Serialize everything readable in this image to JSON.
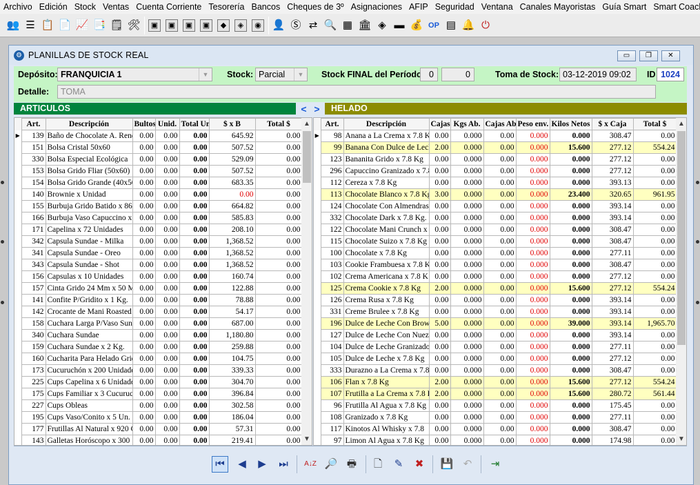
{
  "menu": [
    "Archivo",
    "Edición",
    "Stock",
    "Ventas",
    "Cuenta Corriente",
    "Tesorería",
    "Bancos",
    "Cheques de 3º",
    "Asignaciones",
    "AFIP",
    "Seguridad",
    "Ventana",
    "Canales Mayoristas",
    "Guía Smart",
    "Smart Coach"
  ],
  "toolbar": {
    "group1": [
      "people-icon",
      "list-icon",
      "clipboard-icon",
      "document-icon",
      "chart-icon",
      "report-icon",
      "notepad-icon",
      "tools-icon"
    ],
    "group2": [
      "box1-icon",
      "box2-icon",
      "box3-icon",
      "box4-icon",
      "box5-icon",
      "box6-icon",
      "box7-icon"
    ],
    "group3": [
      "user-icon",
      "money-icon",
      "transfer-icon",
      "search-icon",
      "calculator-icon",
      "bank-icon",
      "stack-icon",
      "card-icon",
      "wallet-icon",
      "op-icon",
      "receipt-icon",
      "bell-icon",
      "power-icon"
    ],
    "group3_glyphs": [
      "👤",
      "Ⓢ",
      "⇄",
      "🔍",
      "▦",
      "🏛",
      "◈",
      "▬",
      "💰",
      "OP",
      "▤",
      "🔔",
      "⏻"
    ]
  },
  "window": {
    "title": "PLANILLAS DE STOCK REAL",
    "minimize": "▭",
    "restore": "❐",
    "close": "✕"
  },
  "header": {
    "deposito_label": "Depósito:",
    "deposito_value": "FRANQUICIA 1",
    "stock_label": "Stock:",
    "stock_value": "Parcial",
    "stock_final_label": "Stock FINAL del Período:",
    "stock_final_a": "0",
    "stock_final_b": "0",
    "toma_label": "Toma de Stock:",
    "toma_value": "03-12-2019 09:02",
    "id_label": "ID",
    "id_value": "1024",
    "detalle_label": "Detalle:",
    "detalle_value": "TOMA"
  },
  "left": {
    "group_title": "ARTICULOS",
    "columns": [
      "Art.",
      "Descripción",
      "Bultos",
      "Unid.",
      "Total Uni",
      "$ x B",
      "Total $"
    ],
    "rows": [
      [
        "139",
        "Baño de Chocolate A. Rend",
        "0.00",
        "0.00",
        "0.00",
        "645.92",
        "0.00"
      ],
      [
        "151",
        "Bolsa Cristal 50x60",
        "0.00",
        "0.00",
        "0.00",
        "507.52",
        "0.00"
      ],
      [
        "330",
        "Bolsa Especial Ecológica",
        "0.00",
        "0.00",
        "0.00",
        "529.09",
        "0.00"
      ],
      [
        "153",
        "Bolsa Grido Fliar (50x60)",
        "0.00",
        "0.00",
        "0.00",
        "507.52",
        "0.00"
      ],
      [
        "154",
        "Bolsa Grido Grande (40x50",
        "0.00",
        "0.00",
        "0.00",
        "683.35",
        "0.00"
      ],
      [
        "140",
        "Brownie x Unidad",
        "0.00",
        "0.00",
        "0.00",
        "0.00",
        "0.00"
      ],
      [
        "155",
        "Burbuja Grido Batido x 860",
        "0.00",
        "0.00",
        "0.00",
        "664.82",
        "0.00"
      ],
      [
        "166",
        "Burbuja Vaso Capuccino x 9",
        "0.00",
        "0.00",
        "0.00",
        "585.83",
        "0.00"
      ],
      [
        "171",
        "Capelina x 72 Unidades",
        "0.00",
        "0.00",
        "0.00",
        "208.10",
        "0.00"
      ],
      [
        "342",
        "Capsula Sundae  - Milka",
        "0.00",
        "0.00",
        "0.00",
        "1,368.52",
        "0.00"
      ],
      [
        "341",
        "Capsula Sundae  - Oreo",
        "0.00",
        "0.00",
        "0.00",
        "1,368.52",
        "0.00"
      ],
      [
        "343",
        "Capsula Sundae  - Shot",
        "0.00",
        "0.00",
        "0.00",
        "1,368.52",
        "0.00"
      ],
      [
        "156",
        "Capsulas x 10 Unidades",
        "0.00",
        "0.00",
        "0.00",
        "160.74",
        "0.00"
      ],
      [
        "157",
        "Cinta Grido 24 Mm x 50 M",
        "0.00",
        "0.00",
        "0.00",
        "122.88",
        "0.00"
      ],
      [
        "141",
        "Confite P/Gridito x 1 Kg.",
        "0.00",
        "0.00",
        "0.00",
        "78.88",
        "0.00"
      ],
      [
        "142",
        "Crocante de Mani Roasted",
        "0.00",
        "0.00",
        "0.00",
        "54.17",
        "0.00"
      ],
      [
        "158",
        "Cuchara Larga P/Vaso Sund",
        "0.00",
        "0.00",
        "0.00",
        "687.00",
        "0.00"
      ],
      [
        "340",
        "Cuchara Sundae",
        "0.00",
        "0.00",
        "0.00",
        "1,180.80",
        "0.00"
      ],
      [
        "159",
        "Cuchara Sundae x 2 Kg.",
        "0.00",
        "0.00",
        "0.00",
        "259.88",
        "0.00"
      ],
      [
        "160",
        "Cucharita Para Helado Grid",
        "0.00",
        "0.00",
        "0.00",
        "104.75",
        "0.00"
      ],
      [
        "173",
        "Cucuruchón x 200 Unidade",
        "0.00",
        "0.00",
        "0.00",
        "339.33",
        "0.00"
      ],
      [
        "225",
        "Cups Capelina x 6 Unidades",
        "0.00",
        "0.00",
        "0.00",
        "304.70",
        "0.00"
      ],
      [
        "175",
        "Cups Familiar  x 3 Cucuruch",
        "0.00",
        "0.00",
        "0.00",
        "396.84",
        "0.00"
      ],
      [
        "227",
        "Cups Obleas",
        "0.00",
        "0.00",
        "0.00",
        "302.58",
        "0.00"
      ],
      [
        "195",
        "Cups Vaso/Conito x 5 Un.",
        "0.00",
        "0.00",
        "0.00",
        "186.04",
        "0.00"
      ],
      [
        "177",
        "Frutillas Al Natural x 920 C",
        "0.00",
        "0.00",
        "0.00",
        "57.31",
        "0.00"
      ],
      [
        "143",
        "Galletas Horóscopo  x 300",
        "0.00",
        "0.00",
        "0.00",
        "219.41",
        "0.00"
      ]
    ]
  },
  "right": {
    "group_title": "HELADO",
    "nav_prev": "<",
    "nav_next": ">",
    "columns": [
      "Art.",
      "Descripción",
      "Cajas",
      "Kgs Ab.",
      "Cajas Ab.",
      "Peso env.",
      "Kilos Netos",
      "$ x Caja",
      "Total $"
    ],
    "rows": [
      [
        "98",
        "Anana a La Crema x 7.8 K",
        "0.00",
        "0.000",
        "0.00",
        "0.000",
        "0.000",
        "308.47",
        "0.00"
      ],
      [
        "99",
        "Banana Con Dulce de Lech",
        "2.00",
        "0.000",
        "0.00",
        "0.000",
        "15.600",
        "277.12",
        "554.24"
      ],
      [
        "123",
        "Bananita Grido x 7.8 Kg",
        "0.00",
        "0.000",
        "0.00",
        "0.000",
        "0.000",
        "277.12",
        "0.00"
      ],
      [
        "296",
        "Capuccino Granizado x 7.8",
        "0.00",
        "0.000",
        "0.00",
        "0.000",
        "0.000",
        "277.12",
        "0.00"
      ],
      [
        "112",
        "Cereza x 7.8 Kg",
        "0.00",
        "0.000",
        "0.00",
        "0.000",
        "0.000",
        "393.13",
        "0.00"
      ],
      [
        "113",
        "Chocolate Blanco x 7.8 Kg",
        "3.00",
        "0.000",
        "0.00",
        "0.000",
        "23.400",
        "320.65",
        "961.95"
      ],
      [
        "124",
        "Chocolate Con Almendras",
        "0.00",
        "0.000",
        "0.00",
        "0.000",
        "0.000",
        "393.14",
        "0.00"
      ],
      [
        "332",
        "Chocolate Dark x 7.8 Kg.",
        "0.00",
        "0.000",
        "0.00",
        "0.000",
        "0.000",
        "393.14",
        "0.00"
      ],
      [
        "122",
        "Chocolate Mani Crunch x",
        "0.00",
        "0.000",
        "0.00",
        "0.000",
        "0.000",
        "308.47",
        "0.00"
      ],
      [
        "115",
        "Chocolate Suizo x 7.8 Kg",
        "0.00",
        "0.000",
        "0.00",
        "0.000",
        "0.000",
        "308.47",
        "0.00"
      ],
      [
        "100",
        "Chocolate x 7.8 Kg",
        "0.00",
        "0.000",
        "0.00",
        "0.000",
        "0.000",
        "277.11",
        "0.00"
      ],
      [
        "103",
        "Cookie Frambuesa x 7.8 K",
        "0.00",
        "0.000",
        "0.00",
        "0.000",
        "0.000",
        "308.47",
        "0.00"
      ],
      [
        "102",
        "Crema Americana x 7.8 K",
        "0.00",
        "0.000",
        "0.00",
        "0.000",
        "0.000",
        "277.12",
        "0.00"
      ],
      [
        "125",
        "Crema Cookie x 7.8 Kg",
        "2.00",
        "0.000",
        "0.00",
        "0.000",
        "15.600",
        "277.12",
        "554.24"
      ],
      [
        "126",
        "Crema Rusa x 7.8 Kg",
        "0.00",
        "0.000",
        "0.00",
        "0.000",
        "0.000",
        "393.14",
        "0.00"
      ],
      [
        "331",
        "Creme Brulee x 7.8 Kg",
        "0.00",
        "0.000",
        "0.00",
        "0.000",
        "0.000",
        "393.14",
        "0.00"
      ],
      [
        "196",
        "Dulce de Leche Con Brow",
        "5.00",
        "0.000",
        "0.00",
        "0.000",
        "39.000",
        "393.14",
        "1,965.70"
      ],
      [
        "127",
        "Dulce de Leche Con Nuez",
        "0.00",
        "0.000",
        "0.00",
        "0.000",
        "0.000",
        "393.14",
        "0.00"
      ],
      [
        "104",
        "Dulce de Leche Granizado",
        "0.00",
        "0.000",
        "0.00",
        "0.000",
        "0.000",
        "277.11",
        "0.00"
      ],
      [
        "105",
        "Dulce de Leche x 7.8 Kg",
        "0.00",
        "0.000",
        "0.00",
        "0.000",
        "0.000",
        "277.12",
        "0.00"
      ],
      [
        "333",
        "Durazno a La Crema x 7.8",
        "0.00",
        "0.000",
        "0.00",
        "0.000",
        "0.000",
        "308.47",
        "0.00"
      ],
      [
        "106",
        "Flan x 7.8 Kg",
        "2.00",
        "0.000",
        "0.00",
        "0.000",
        "15.600",
        "277.12",
        "554.24"
      ],
      [
        "107",
        "Frutilla a La Crema x 7.8 K",
        "2.00",
        "0.000",
        "0.00",
        "0.000",
        "15.600",
        "280.72",
        "561.44"
      ],
      [
        "96",
        "Frutilla Al Agua x 7.8 Kg",
        "0.00",
        "0.000",
        "0.00",
        "0.000",
        "0.000",
        "175.45",
        "0.00"
      ],
      [
        "108",
        "Granizado x 7.8 Kg",
        "0.00",
        "0.000",
        "0.00",
        "0.000",
        "0.000",
        "277.11",
        "0.00"
      ],
      [
        "117",
        "Kinotos Al Whisky x 7.8",
        "0.00",
        "0.000",
        "0.00",
        "0.000",
        "0.000",
        "308.47",
        "0.00"
      ],
      [
        "97",
        "Limon Al Agua x 7.8 Kg",
        "0.00",
        "0.000",
        "0.00",
        "0.000",
        "0.000",
        "174.98",
        "0.00"
      ]
    ]
  },
  "navbar": {
    "first": "⏮",
    "prev": "◀",
    "next": "▶",
    "last": "⏭",
    "sort": "A↓Z",
    "find": "🔎",
    "print": "🖶",
    "new": "🗋",
    "edit": "✎",
    "delete": "✖",
    "save": "💾",
    "undo": "↶",
    "exit": "⇥"
  },
  "colors": {
    "green_bar": "#00843d",
    "olive_bar": "#8c8c00",
    "header_bg": "#c5f5c5",
    "highlight_row": "#ffffc0",
    "negative": "#e00000"
  }
}
